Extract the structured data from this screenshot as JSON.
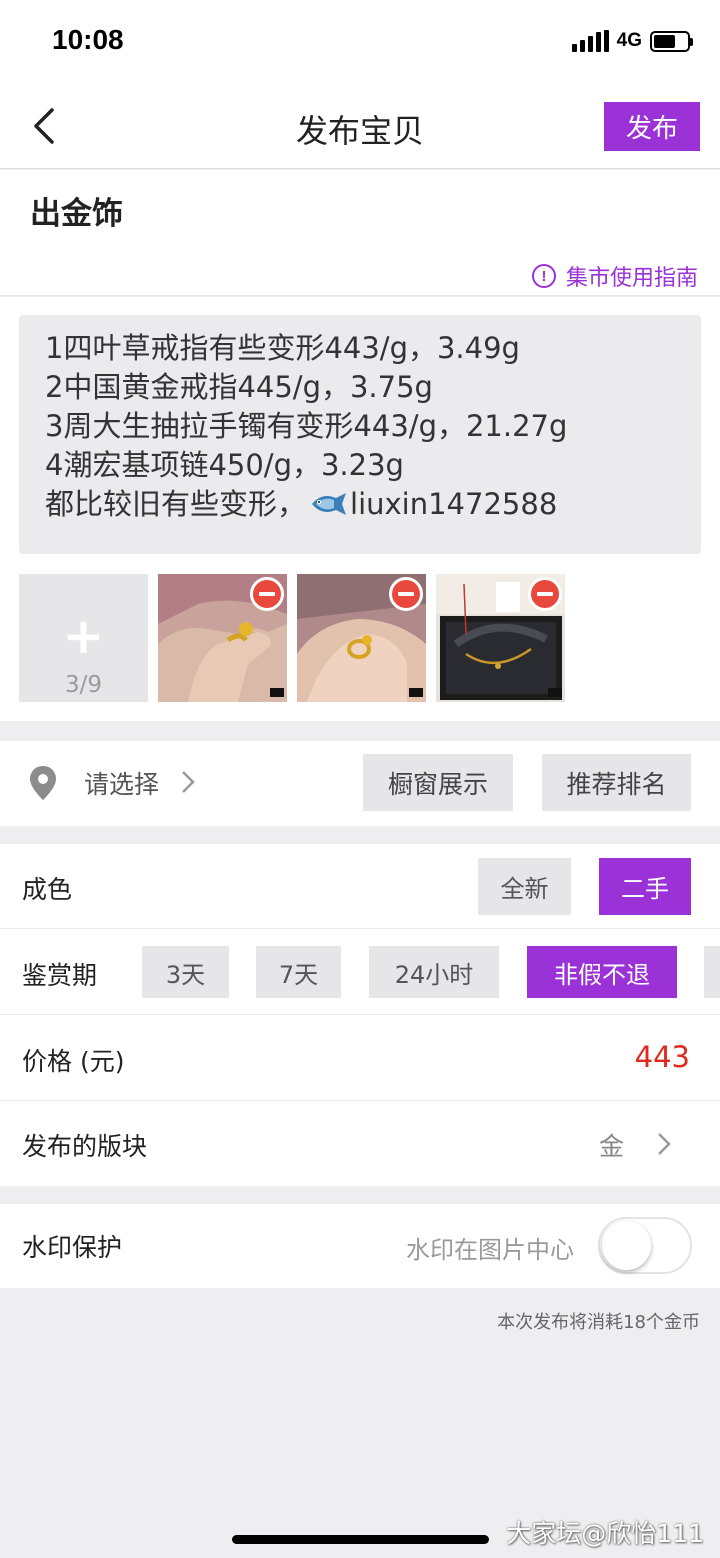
{
  "status_bar": {
    "time": "10:08",
    "network": "4G",
    "battery_level": 0.65
  },
  "nav": {
    "title": "发布宝贝",
    "publish_label": "发布"
  },
  "category": {
    "title": "出金饰",
    "guide_label": "集市使用指南",
    "guide_icon": "info-circle-icon"
  },
  "description": {
    "lines": [
      "1四叶草戒指有些变形443/g，3.49g",
      "2中国黄金戒指445/g，3.75g",
      "3周大生抽拉手镯有变形443/g，21.27g",
      "4潮宏基项链450/g，3.23g"
    ],
    "last_line_prefix": "都比较旧有些变形，",
    "last_line_suffix": "liuxin1472588",
    "inline_icon": "fish-emoji-icon"
  },
  "photos": {
    "add_icon": "plus-icon",
    "count_label": "3/9",
    "items": [
      {
        "name": "ring-on-finger-photo",
        "remove_icon": "remove-circle-icon"
      },
      {
        "name": "ring-in-palm-photo",
        "remove_icon": "remove-circle-icon"
      },
      {
        "name": "necklace-in-box-photo",
        "remove_icon": "remove-circle-icon"
      }
    ]
  },
  "location": {
    "icon": "location-pin-icon",
    "placeholder": "请选择",
    "chips": [
      "橱窗展示",
      "推荐排名"
    ]
  },
  "condition": {
    "label": "成色",
    "options": [
      "全新",
      "二手"
    ],
    "selected": "二手"
  },
  "appreciation": {
    "label": "鉴赏期",
    "options": [
      "3天",
      "7天",
      "24小时",
      "非假不退"
    ],
    "selected": "非假不退"
  },
  "price": {
    "label": "价格 (元)",
    "value": "443"
  },
  "board": {
    "label": "发布的版块",
    "value": "金"
  },
  "watermark": {
    "label": "水印保护",
    "description": "水印在图片中心",
    "enabled": false
  },
  "cost_note": "本次发布将消耗18个金币",
  "overlay_watermark": "大家坛@欣怡111",
  "colors": {
    "accent": "#9a32d8",
    "price": "#e0281c",
    "remove": "#e9493c"
  }
}
